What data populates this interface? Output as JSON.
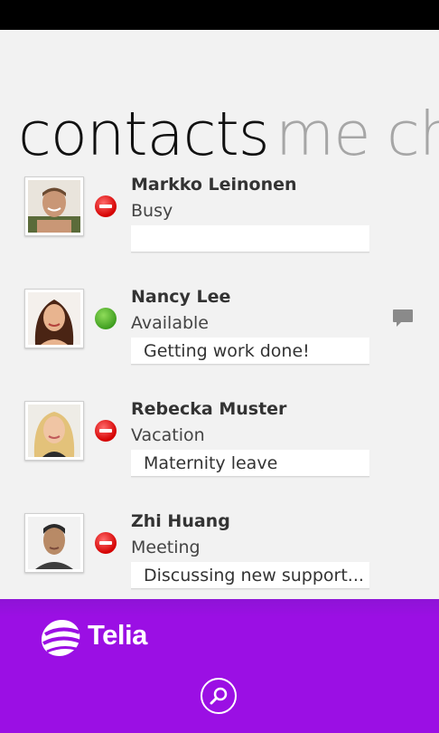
{
  "pivot": {
    "active": "contacts",
    "items": [
      "me",
      "ch"
    ]
  },
  "contacts": [
    {
      "name": "Markko Leinonen",
      "status": "Busy",
      "note": "",
      "presence": "busy"
    },
    {
      "name": "Nancy Lee",
      "status": "Available",
      "note": "Getting work done!",
      "presence": "available",
      "has_chat": true
    },
    {
      "name": "Rebecka Muster",
      "status": "Vacation",
      "note": "Maternity leave",
      "presence": "busy"
    },
    {
      "name": "Zhi Huang",
      "status": "Meeting",
      "note": "Discussing new support...",
      "presence": "busy"
    }
  ],
  "appbar": {
    "brand": "Telia",
    "brand_color": "#9b0fe4",
    "search_icon": "search-icon"
  }
}
